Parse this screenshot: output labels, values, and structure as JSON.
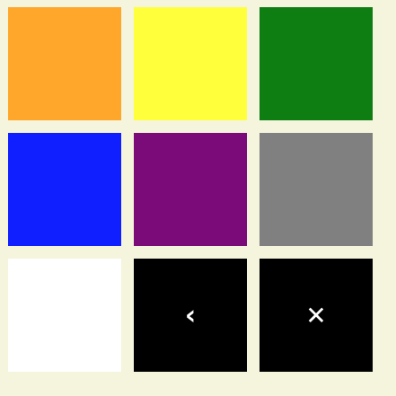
{
  "palette": {
    "swatches": [
      {
        "name": "orange",
        "color": "#ffa72b"
      },
      {
        "name": "yellow",
        "color": "#ffff3c"
      },
      {
        "name": "green",
        "color": "#0e7d12"
      },
      {
        "name": "blue",
        "color": "#0f1fff"
      },
      {
        "name": "purple",
        "color": "#7a0b79"
      },
      {
        "name": "gray",
        "color": "#808080"
      },
      {
        "name": "white",
        "color": "#ffffff"
      }
    ],
    "back_button": {
      "icon": "chevron-left-icon",
      "glyph": "‹",
      "color": "#000000"
    },
    "close_button": {
      "icon": "close-icon",
      "glyph": "✕",
      "color": "#000000"
    },
    "background_color": "#f5f4dc"
  }
}
